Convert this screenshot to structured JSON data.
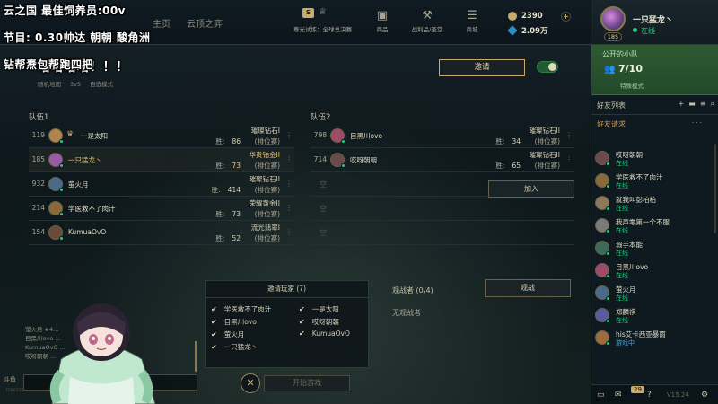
{
  "overlay": {
    "line1": "云之国  最佳饲养员:00v",
    "line2": "节目: 0.30帅达 朝朝 酸角洲",
    "line3": "钻帮焘包帮跑四把"
  },
  "topbar": {
    "tabs": [
      "主页",
      "云顶之弈"
    ],
    "mode_chip_letter": "S",
    "mode_chip_label": "尊光试炼：全球总决赛",
    "nav": [
      {
        "label": "商品",
        "icon": "shop-icon"
      },
      {
        "label": "战利品/圣堂",
        "icon": "loot-icon"
      },
      {
        "label": "商城",
        "icon": "store-icon"
      }
    ],
    "blue_essence": "2390",
    "riot_points": "2.09万"
  },
  "lobby": {
    "title": "哈哈哈哈！！！",
    "map": "随机地图",
    "size": "5v5",
    "mode": "自选模式",
    "invite_label": "邀请"
  },
  "team1": {
    "label": "队伍1",
    "players": [
      {
        "level": "119",
        "name": "一是太阳",
        "rank": "璀璨钻石I",
        "wins_label": "胜:",
        "wins": "86",
        "queue": "(排位赛)",
        "owner": true,
        "me": false,
        "avatar_color": "#b0844a"
      },
      {
        "level": "185",
        "name": "一只猛龙丶",
        "rank": "华贵铂金II",
        "wins_label": "胜:",
        "wins": "73",
        "queue": "(排位赛)",
        "owner": false,
        "me": true,
        "avatar_color": "#9a5aa8"
      },
      {
        "level": "932",
        "name": "萤火月",
        "rank": "璀璨钻石II",
        "wins_label": "胜:",
        "wins": "414",
        "queue": "(排位赛)",
        "owner": false,
        "me": false,
        "avatar_color": "#4a6a8a"
      },
      {
        "level": "214",
        "name": "学医救不了肉汁",
        "rank": "荣耀黄金II",
        "wins_label": "胜:",
        "wins": "73",
        "queue": "(排位赛)",
        "owner": false,
        "me": false,
        "avatar_color": "#8a6a3a"
      },
      {
        "level": "154",
        "name": "KumuaOvO",
        "rank": "流光翡翠I",
        "wins_label": "胜:",
        "wins": "52",
        "queue": "(排位赛)",
        "owner": false,
        "me": false,
        "avatar_color": "#6a4a3a"
      }
    ]
  },
  "team2": {
    "label": "队伍2",
    "players": [
      {
        "level": "798",
        "name": "目黑川ovo",
        "rank": "璀璨钻石II",
        "wins_label": "胜:",
        "wins": "34",
        "queue": "(排位赛)",
        "avatar_color": "#a04a6a"
      },
      {
        "level": "714",
        "name": "哎呀朝朝",
        "rank": "璀璨钻石II",
        "wins_label": "胜:",
        "wins": "65",
        "queue": "(排位赛)",
        "avatar_color": "#6a4a4a"
      }
    ],
    "empty_label": "空",
    "join_label": "加入"
  },
  "invited": {
    "title": "邀请玩家 (7)",
    "players": [
      "学医救不了肉汁",
      "一是太阳",
      "目黑川ovo",
      "哎呀朝朝",
      "萤火月",
      "KumuaOvO",
      "一只猛龙丶"
    ]
  },
  "spectators": {
    "title": "观战者 (0/4)",
    "none": "无观战者",
    "button": "观战"
  },
  "start_label": "开始游戏",
  "chat": {
    "lines": [
      "萤火月 #4...",
      "目黑川ovo ...",
      "KumuaOvO ...",
      "哎呀朝朝 ..."
    ]
  },
  "watermark": "斗鱼",
  "watermark_id": "7290155",
  "right_panel": {
    "name": "一只猛龙丶",
    "level": "185",
    "status": "在线",
    "lobby_title": "公开的小队",
    "lobby_count": "7/10",
    "lobby_mode": "特殊模式",
    "friend_list_title": "好友列表",
    "friend_requests": "好友请求",
    "friends": [
      {
        "name": "哎呀朝朝",
        "status": "在线",
        "color": "#6a4a4a"
      },
      {
        "name": "学医救不了肉汁",
        "status": "在线",
        "color": "#8a6a3a"
      },
      {
        "name": "就我叫彭柏柏",
        "status": "在线",
        "color": "#8a7a5a"
      },
      {
        "name": "我声零第一个不服",
        "status": "在线",
        "color": "#7a7a7a"
      },
      {
        "name": "瑕手本能",
        "status": "在线",
        "color": "#3a6a5a"
      },
      {
        "name": "目黑川ovo",
        "status": "在线",
        "color": "#a04a6a"
      },
      {
        "name": "萤火月",
        "status": "在线",
        "color": "#4a6a8a"
      },
      {
        "name": "郑麟祺",
        "status": "在线",
        "color": "#5a5aa0"
      },
      {
        "name": "his艾卡西亚暴雨",
        "status": "游戏中",
        "color": "#a06a3a"
      }
    ],
    "badge_count": "29",
    "version": "V15.24"
  }
}
